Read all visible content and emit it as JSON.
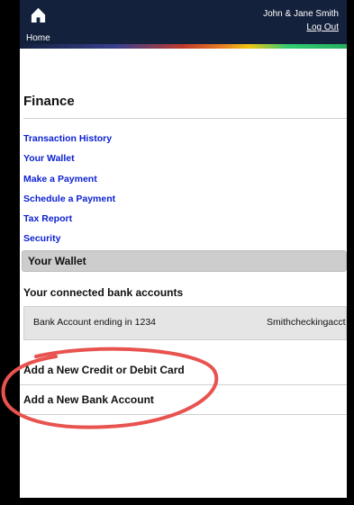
{
  "header": {
    "home_label": "Home",
    "user_name": "John & Jane Smith",
    "logout_label": "Log Out"
  },
  "main": {
    "title": "Finance",
    "nav_links": [
      {
        "label": "Transaction History"
      },
      {
        "label": "Your Wallet"
      },
      {
        "label": "Make a Payment"
      },
      {
        "label": "Schedule a Payment"
      },
      {
        "label": "Tax Report"
      },
      {
        "label": "Security"
      }
    ],
    "section_title": "Your Wallet",
    "connected_title": "Your connected bank accounts",
    "accounts": [
      {
        "label": "Bank Account ending in 1234",
        "name": "Smithcheckingacct"
      }
    ],
    "actions": {
      "add_card": "Add a New Credit or Debit Card",
      "add_bank": "Add a New Bank Account"
    }
  },
  "annotation": {
    "icon": "red-ellipse-highlight",
    "color": "#e8534f"
  },
  "colors": {
    "header_bg": "#14213d",
    "link": "#0a1fd0",
    "section_bar": "#cdcdcd"
  }
}
